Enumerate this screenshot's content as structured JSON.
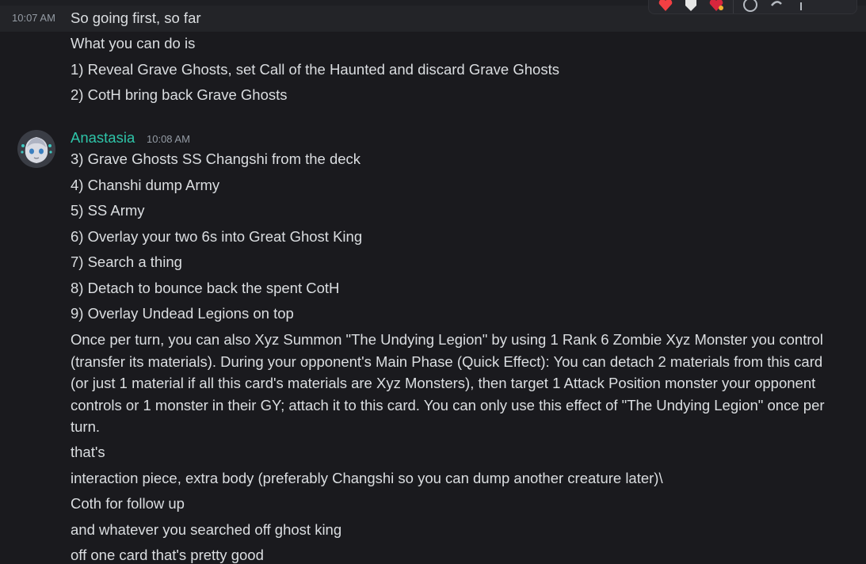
{
  "first_message": {
    "timestamp": "10:07 AM",
    "lines": [
      "So going first, so far",
      "What you can do is",
      "1) Reveal Grave Ghosts, set Call of the Haunted and discard Grave Ghosts",
      "2) CotH bring back Grave Ghosts"
    ]
  },
  "second_message": {
    "author": "Anastasia",
    "author_color": "#2ec4a8",
    "timestamp": "10:08 AM",
    "lines": [
      "3) Grave Ghosts SS Changshi from the deck",
      "4) Chanshi dump Army",
      "5) SS Army",
      "6) Overlay your two 6s into Great Ghost King",
      "7) Search a thing",
      "8) Detach to bounce back the spent CotH",
      "9) Overlay Undead Legions on top"
    ],
    "effect_text": "Once per turn, you can also Xyz Summon \"The Undying Legion\" by using 1 Rank 6 Zombie Xyz Monster you control (transfer its materials). During your opponent's Main Phase (Quick Effect): You can detach 2 materials from this card (or just 1 material if all this card's materials are Xyz Monsters), then target 1 Attack Position monster your opponent controls or 1 monster in their GY; attach it to this card. You can only use this effect of \"The Undying Legion\" once per turn.",
    "after_lines": [
      "that's",
      "interaction piece, extra body (preferably Changshi so you can dump another creature later)\\",
      "Coth for follow up",
      "and whatever you searched off ghost king",
      "off one card that's pretty good"
    ]
  },
  "toolbar": {
    "icons": [
      "heart-reaction-icon",
      "shield-reaction-icon",
      "heart-sparkle-reaction-icon",
      "add-reaction-icon",
      "reply-icon",
      "more-icon"
    ]
  }
}
